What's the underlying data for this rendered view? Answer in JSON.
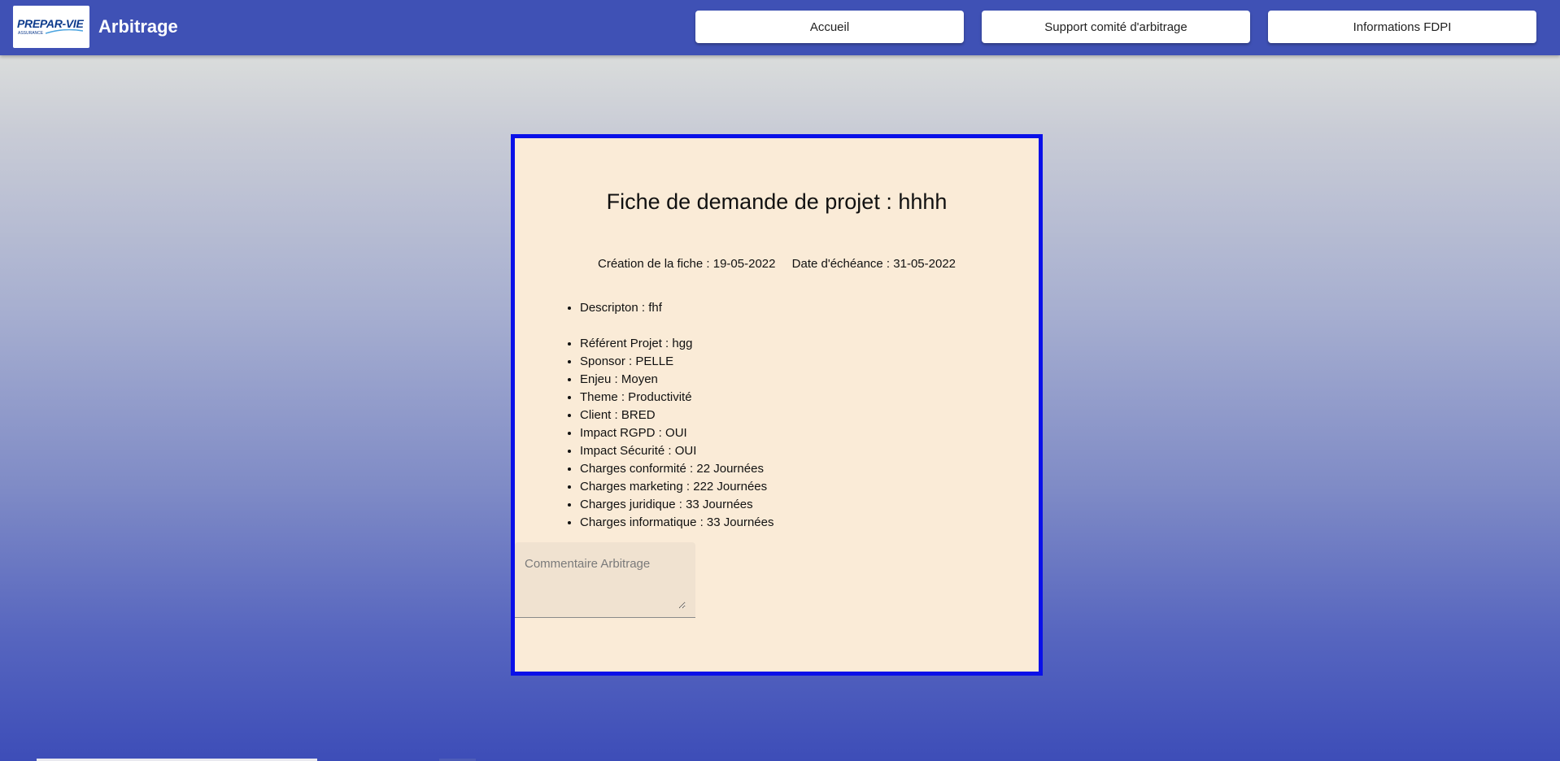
{
  "header": {
    "logo_text": "PREPAR-VIE",
    "logo_subtext": "ASSURANCE",
    "app_title": "Arbitrage",
    "nav": [
      {
        "label": "Accueil"
      },
      {
        "label": "Support comité d'arbitrage"
      },
      {
        "label": "Informations FDPI"
      }
    ]
  },
  "card": {
    "title": "Fiche de demande de projet : hhhh",
    "creation_date": "Création de la fiche : 19-05-2022",
    "due_date": "Date d'échéance : 31-05-2022",
    "description": "Descripton : fhf",
    "items": [
      "Référent Projet : hgg",
      "Sponsor : PELLE",
      "Enjeu : Moyen",
      "Theme : Productivité",
      "Client : BRED",
      "Impact RGPD : OUI",
      "Impact Sécurité : OUI",
      "Charges conformité : 22 Journées",
      "Charges marketing : 222 Journées",
      "Charges juridique : 33 Journées",
      "Charges informatique : 33 Journées"
    ],
    "comment": {
      "placeholder": "Commentaire Arbitrage",
      "value": ""
    }
  },
  "colors": {
    "topbar": "#3f51b5",
    "card_border": "#0a10e8",
    "card_background": "#faebd7"
  }
}
